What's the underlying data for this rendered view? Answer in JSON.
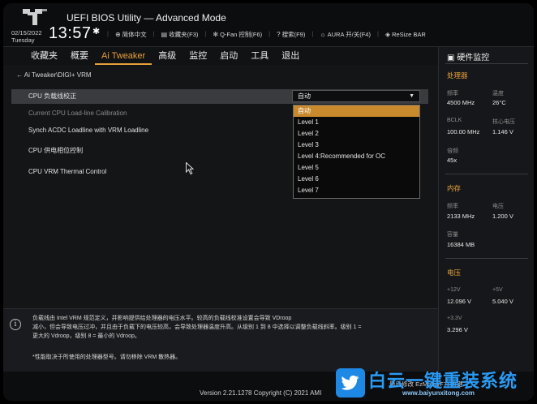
{
  "header": {
    "title": "UEFI BIOS Utility — Advanced Mode",
    "date": "02/15/2022",
    "day": "Tuesday",
    "time": "13:57",
    "toolbar": [
      {
        "icon": "globe-icon",
        "label": "简体中文"
      },
      {
        "icon": "bookmark-icon",
        "label": "收藏夹(F3)"
      },
      {
        "icon": "fan-icon",
        "label": "Q-Fan 控制(F6)"
      },
      {
        "icon": "help-icon",
        "label": "搜索(F9)"
      },
      {
        "icon": "aura-icon",
        "label": "AURA 开/关(F4)"
      },
      {
        "icon": "resize-icon",
        "label": "ReSize BAR"
      }
    ]
  },
  "nav": {
    "tabs": [
      "收藏夹",
      "概要",
      "Ai Tweaker",
      "高级",
      "监控",
      "启动",
      "工具",
      "退出"
    ],
    "active": "Ai Tweaker"
  },
  "main": {
    "breadcrumb": "Ai Tweaker\\DIGI+ VRM",
    "rows": [
      "CPU 负载线校正",
      "Current CPU Load-line Calibration",
      "Synch ACDC Loadline with VRM Loadline",
      "CPU 供电相位控制",
      "CPU VRM Thermal Control"
    ],
    "select_value": "自动",
    "dropdown_options": [
      "自动",
      "Level 1",
      "Level 2",
      "Level 3",
      "Level 4:Recommended for OC",
      "Level 5",
      "Level 6",
      "Level 7"
    ]
  },
  "help": {
    "line1": "负载线由 Intel VRM 规范定义，并影响提供给处理器的电压水平。较高的负载线校准设置会导致 VDroop",
    "line2": "减小，但会导致电压过冲，并且由于负载下的电压较高，会导致处理器温度升高。从级别 1 到 8 中选择以调整负载线斜率。级别 1 =",
    "line3": "更大的 Vdroop，级别 8 = 最小的 Vdroop。",
    "note": "*性能取决于所使用的处理器型号。请勿移除 VRM 散热器。"
  },
  "monitor": {
    "title": "硬件监控",
    "cpu": {
      "section": "处理器",
      "freq_label": "频率",
      "freq": "4500 MHz",
      "temp_label": "温度",
      "temp": "26°C",
      "bclk_label": "BCLK",
      "bclk": "100.00 MHz",
      "vcore_label": "核心电压",
      "vcore": "1.146 V",
      "ratio_label": "倍频",
      "ratio": "45x"
    },
    "memory": {
      "section": "内存",
      "freq_label": "频率",
      "freq": "2133 MHz",
      "volt_label": "电压",
      "volt": "1.200 V",
      "cap_label": "容量",
      "cap": "16384 MB"
    },
    "voltage": {
      "section": "电压",
      "v12_label": "+12V",
      "v12": "12.096 V",
      "v5_label": "+5V",
      "v5": "5.040 V",
      "v33_label": "+3.3V",
      "v33": "3.296 V"
    }
  },
  "footer": {
    "version": "Version 2.21.1278 Copyright (C) 2021 AMI",
    "links": "最后修改    EzMode(F7)    热键"
  },
  "watermark": {
    "text": "白云一键重装系统",
    "url": "www.baiyunxitong.com"
  },
  "colors": {
    "accent": "#e8a13a",
    "selected_option": "#c98a2e",
    "watermark_blue": "#2b9af3"
  }
}
